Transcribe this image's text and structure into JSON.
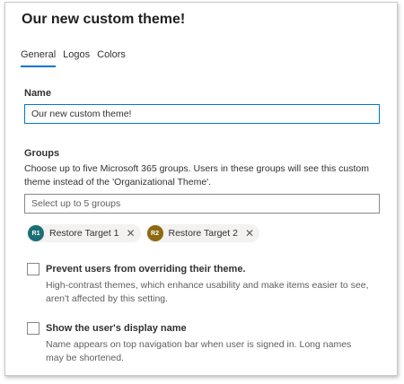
{
  "title": "Our new custom theme!",
  "tabs": [
    {
      "label": "General",
      "active": true
    },
    {
      "label": "Logos",
      "active": false
    },
    {
      "label": "Colors",
      "active": false
    }
  ],
  "name": {
    "label": "Name",
    "value": "Our new custom theme!"
  },
  "groups": {
    "label": "Groups",
    "description": "Choose up to five Microsoft 365 groups. Users in these groups will see this custom theme instead of the 'Organizational Theme'.",
    "placeholder": "Select up to 5 groups",
    "selected": [
      {
        "initials": "R1",
        "label": "Restore Target 1",
        "color": "#1b6f74",
        "remove": "✕"
      },
      {
        "initials": "R2",
        "label": "Restore Target 2",
        "color": "#8d6a10",
        "remove": "✕"
      }
    ]
  },
  "prevent_override": {
    "label": "Prevent users from overriding their theme.",
    "description": "High-contrast themes, which enhance usability and make items easier to see, aren't affected by this setting.",
    "checked": false
  },
  "show_display_name": {
    "label": "Show the user's display name",
    "description": "Name appears on top navigation bar when user is signed in. Long names may be shortened.",
    "checked": false
  },
  "colors": {
    "accent": "#0078d4"
  }
}
